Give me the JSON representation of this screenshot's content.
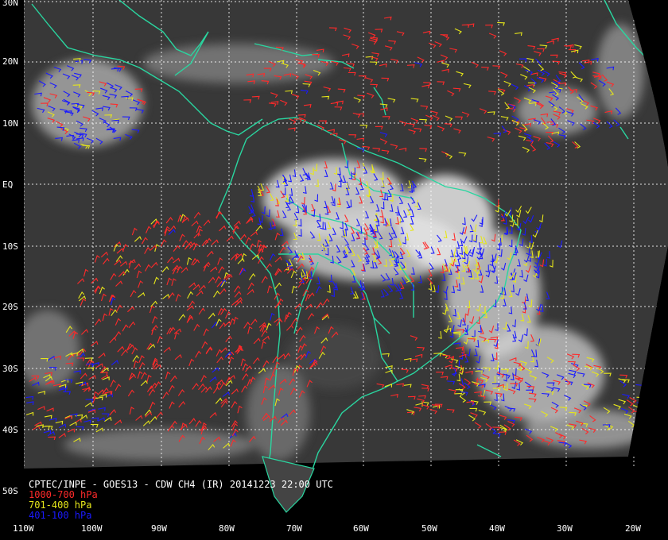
{
  "image": {
    "satellite": "GOES13",
    "product": "CDW CH4 (IR)"
  },
  "caption": {
    "line": "CPTEC/INPE - GOES13 - CDW CH4 (IR) 20141223 22:00 UTC"
  },
  "legend": [
    {
      "label": "1000-700 hPa",
      "color": "#ff2a2a"
    },
    {
      "label": "701-400 hPa",
      "color": "#e6e61a"
    },
    {
      "label": "401-100 hPa",
      "color": "#1a1aff"
    }
  ],
  "lat_labels": [
    "30N",
    "20N",
    "10N",
    "EQ",
    "10S",
    "20S",
    "30S",
    "40S",
    "50S"
  ],
  "lon_labels": [
    "110W",
    "100W",
    "90W",
    "80W",
    "70W",
    "60W",
    "50W",
    "40W",
    "30W",
    "20W"
  ],
  "colors": {
    "coastline": "#2ad6a0",
    "grid": "#ffffff",
    "space": "#000000",
    "earth": "#3a3a3a",
    "clouds": "#e8e8e8"
  }
}
